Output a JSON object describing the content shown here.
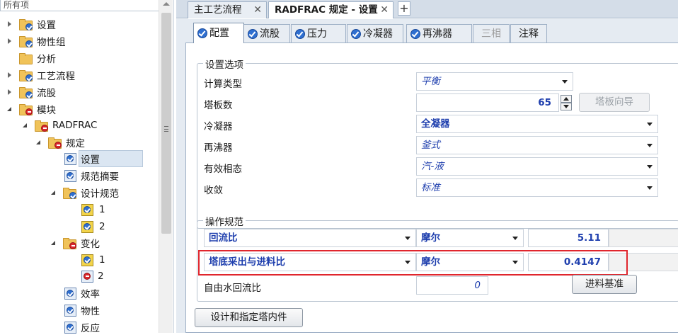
{
  "nav": {
    "filter": "所有项",
    "items": [
      {
        "label": "设置",
        "icon": "folder-ok-icon",
        "expander": "closed"
      },
      {
        "label": "物性组",
        "icon": "folder-ok-icon",
        "expander": "closed"
      },
      {
        "label": "分析",
        "icon": "folder-icon",
        "expander": "none"
      },
      {
        "label": "工艺流程",
        "icon": "folder-ok-icon",
        "expander": "closed"
      },
      {
        "label": "流股",
        "icon": "folder-ok-icon",
        "expander": "closed"
      },
      {
        "label": "模块",
        "icon": "folder-error-icon",
        "expander": "open"
      },
      {
        "label": "RADFRAC",
        "icon": "folder-error-icon",
        "expander": "open"
      },
      {
        "label": "规定",
        "icon": "folder-error-icon",
        "expander": "open"
      },
      {
        "label": "设置",
        "icon": "form-ok-icon",
        "expander": "none",
        "selected": true
      },
      {
        "label": "规范摘要",
        "icon": "form-ok-icon",
        "expander": "none"
      },
      {
        "label": "设计规范",
        "icon": "folder-ok-icon",
        "expander": "open"
      },
      {
        "label": "1",
        "icon": "checklist-ok-icon",
        "expander": "none"
      },
      {
        "label": "2",
        "icon": "checklist-ok-icon",
        "expander": "none"
      },
      {
        "label": "变化",
        "icon": "folder-error-icon",
        "expander": "open"
      },
      {
        "label": "1",
        "icon": "checklist-ok-icon",
        "expander": "none"
      },
      {
        "label": "2",
        "icon": "form-error-icon",
        "expander": "none"
      },
      {
        "label": "效率",
        "icon": "form-ok-icon",
        "expander": "none"
      },
      {
        "label": "物性",
        "icon": "form-ok-icon",
        "expander": "none"
      },
      {
        "label": "反应",
        "icon": "form-ok-icon",
        "expander": "none"
      }
    ]
  },
  "doc_tabs": [
    {
      "label": "主工艺流程",
      "active": false
    },
    {
      "label": "RADFRAC 规定 - 设置",
      "active": true
    }
  ],
  "doc_tab_new": "+",
  "sub_tabs": [
    {
      "label": "配置",
      "check": true,
      "active": true
    },
    {
      "label": "流股",
      "check": true
    },
    {
      "label": "压力",
      "check": true
    },
    {
      "label": "冷凝器",
      "check": true
    },
    {
      "label": "再沸器",
      "check": true
    },
    {
      "label": "三相",
      "check": false,
      "disabled": true
    },
    {
      "label": "注释",
      "check": false
    }
  ],
  "setup_group": {
    "title": "设置选项",
    "calc_type": {
      "label": "计算类型",
      "value": "平衡"
    },
    "stages": {
      "label": "塔板数",
      "value": "65",
      "wizard_button": "塔板向导"
    },
    "condenser": {
      "label": "冷凝器",
      "value": "全凝器"
    },
    "reboiler": {
      "label": "再沸器",
      "value": "釜式"
    },
    "valid_phases": {
      "label": "有效相态",
      "value": "汽-液"
    },
    "convergence": {
      "label": "收敛",
      "value": "标准"
    }
  },
  "op_group": {
    "title": "操作规范",
    "spec1": {
      "name": "回流比",
      "basis": "摩尔",
      "value": "5.11"
    },
    "spec2": {
      "name": "塔底采出与进料比",
      "basis": "摩尔",
      "value": "0.4147"
    },
    "free_water": {
      "label": "自由水回流比",
      "value": "0",
      "button": "进料基准"
    }
  },
  "bottom_button": "设计和指定塔内件",
  "colors": {
    "accent_blue": "#1f3fae",
    "highlight_red": "#e0262d",
    "ok_badge": "#2f6fd0",
    "error_badge": "#d8262b"
  }
}
